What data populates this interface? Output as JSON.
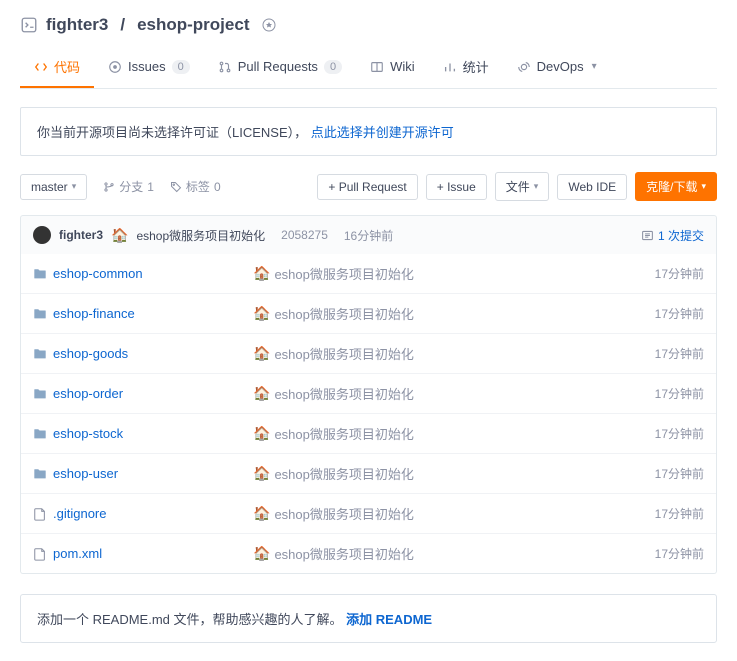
{
  "header": {
    "owner": "fighter3",
    "project": "eshop-project"
  },
  "tabs": {
    "code": "代码",
    "issues": "Issues",
    "issues_count": "0",
    "pulls": "Pull Requests",
    "pulls_count": "0",
    "wiki": "Wiki",
    "stats": "统计",
    "devops": "DevOps"
  },
  "notice": {
    "text_before": "你当前开源项目尚未选择许可证（LICENSE），",
    "link": "点此选择并创建开源许可"
  },
  "toolbar": {
    "branch": "master",
    "branches_label": "分支",
    "branches_count": "1",
    "tags_label": "标签",
    "tags_count": "0",
    "pull_request": "+ Pull Request",
    "issue": "+ Issue",
    "files": "文件",
    "web_ide": "Web IDE",
    "clone": "克隆/下载"
  },
  "commit_bar": {
    "author": "fighter3",
    "message": "eshop微服务项目初始化",
    "sha": "2058275",
    "time": "16分钟前",
    "commits_count": "1 次提交"
  },
  "files": [
    {
      "name": "eshop-common",
      "type": "folder",
      "msg": "eshop微服务项目初始化",
      "time": "17分钟前"
    },
    {
      "name": "eshop-finance",
      "type": "folder",
      "msg": "eshop微服务项目初始化",
      "time": "17分钟前"
    },
    {
      "name": "eshop-goods",
      "type": "folder",
      "msg": "eshop微服务项目初始化",
      "time": "17分钟前"
    },
    {
      "name": "eshop-order",
      "type": "folder",
      "msg": "eshop微服务项目初始化",
      "time": "17分钟前"
    },
    {
      "name": "eshop-stock",
      "type": "folder",
      "msg": "eshop微服务项目初始化",
      "time": "17分钟前"
    },
    {
      "name": "eshop-user",
      "type": "folder",
      "msg": "eshop微服务项目初始化",
      "time": "17分钟前"
    },
    {
      "name": ".gitignore",
      "type": "file",
      "msg": "eshop微服务项目初始化",
      "time": "17分钟前"
    },
    {
      "name": "pom.xml",
      "type": "file",
      "msg": "eshop微服务项目初始化",
      "time": "17分钟前"
    }
  ],
  "readme_prompt": {
    "text": "添加一个 README.md 文件，帮助感兴趣的人了解。",
    "link": "添加 README"
  }
}
